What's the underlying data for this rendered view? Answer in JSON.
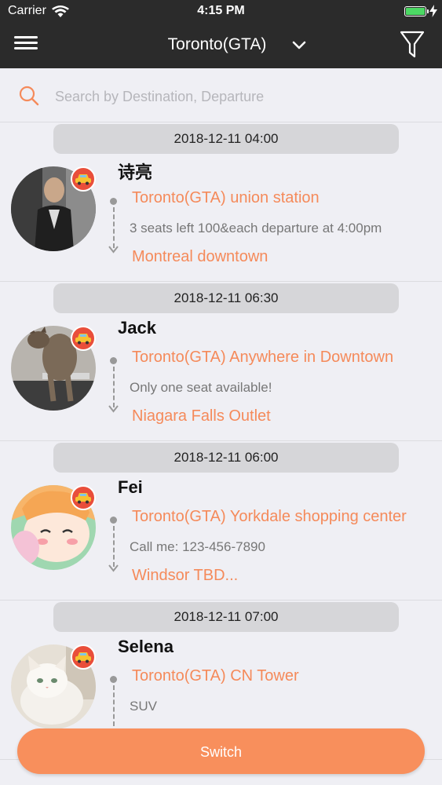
{
  "status_bar": {
    "carrier": "Carrier",
    "time": "4:15 PM"
  },
  "nav": {
    "title": "Toronto(GTA)"
  },
  "search": {
    "placeholder": "Search by Destination, Departure"
  },
  "trips": [
    {
      "date": "2018-12-11 04:00",
      "name": "诗亮",
      "from": "Toronto(GTA) union station",
      "note": "3 seats left 100&each departure at 4:00pm",
      "to": "Montreal downtown",
      "avatar": "person-photo"
    },
    {
      "date": "2018-12-11 06:30",
      "name": "Jack",
      "from": "Toronto(GTA) Anywhere in Downtown",
      "note": "Only one seat available!",
      "to": "Niagara Falls Outlet",
      "avatar": "cat-photo"
    },
    {
      "date": "2018-12-11 06:00",
      "name": "Fei",
      "from": "Toronto(GTA) Yorkdale shopping center",
      "note": "Call me: 123-456-7890",
      "to": "Windsor TBD...",
      "avatar": "anime-girl-image"
    },
    {
      "date": "2018-12-11 07:00",
      "name": "Selena",
      "from": "Toronto(GTA) CN Tower",
      "note": "SUV",
      "to": "",
      "avatar": "white-cat-photo"
    }
  ],
  "switch_button": {
    "label": "Switch"
  },
  "colors": {
    "accent": "#f58a5a",
    "button": "#f88f5c",
    "header": "#2b2b2b",
    "badge": "#e94e3a"
  }
}
